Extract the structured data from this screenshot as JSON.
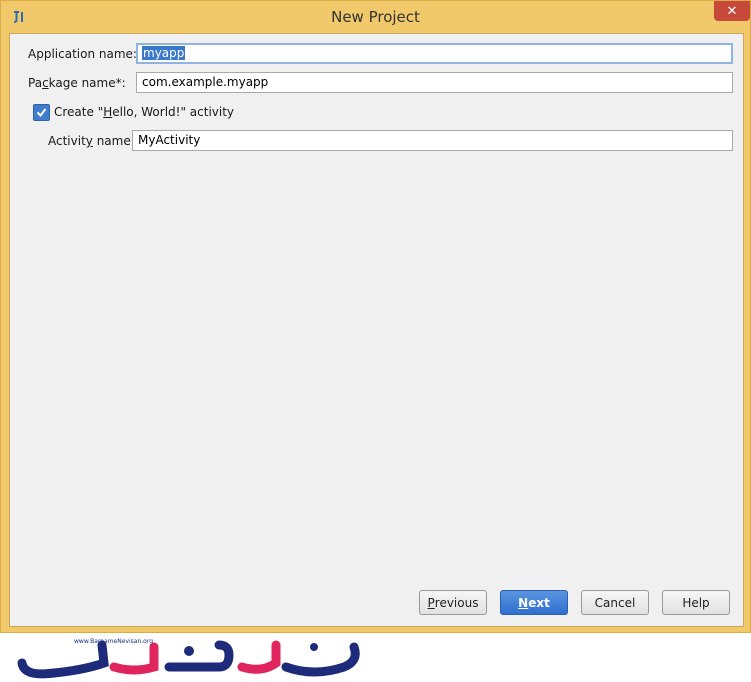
{
  "window": {
    "title": "New Project",
    "close_glyph": "✕",
    "colors": {
      "frame": "#f1c96a",
      "client": "#f0f0f0",
      "accent": "#3f7ccd",
      "close": "#c7493a"
    }
  },
  "form": {
    "app_name": {
      "label_pre": "Application name:",
      "value": "myapp"
    },
    "package_name": {
      "label_pre": "Pa",
      "label_mn": "c",
      "label_post": "kage name*:",
      "value": "com.example.myapp"
    },
    "create_activity": {
      "label_pre": "Create \"",
      "label_mn": "H",
      "label_post": "ello, World!\" activity",
      "checked": true
    },
    "activity_name": {
      "label_pre": "Activit",
      "label_mn": "y",
      "label_post": " name",
      "value": "MyActivity"
    }
  },
  "buttons": {
    "previous": {
      "mn": "P",
      "rest": "revious"
    },
    "next": {
      "mn": "N",
      "rest": "ext"
    },
    "cancel": "Cancel",
    "help": "Help"
  },
  "watermark": {
    "url": "www.BarnameNevisan.org",
    "logo": "برنامه نویسان"
  },
  "icons": {
    "app": "intellij-icon",
    "check": "checkmark-icon",
    "close": "close-icon"
  }
}
